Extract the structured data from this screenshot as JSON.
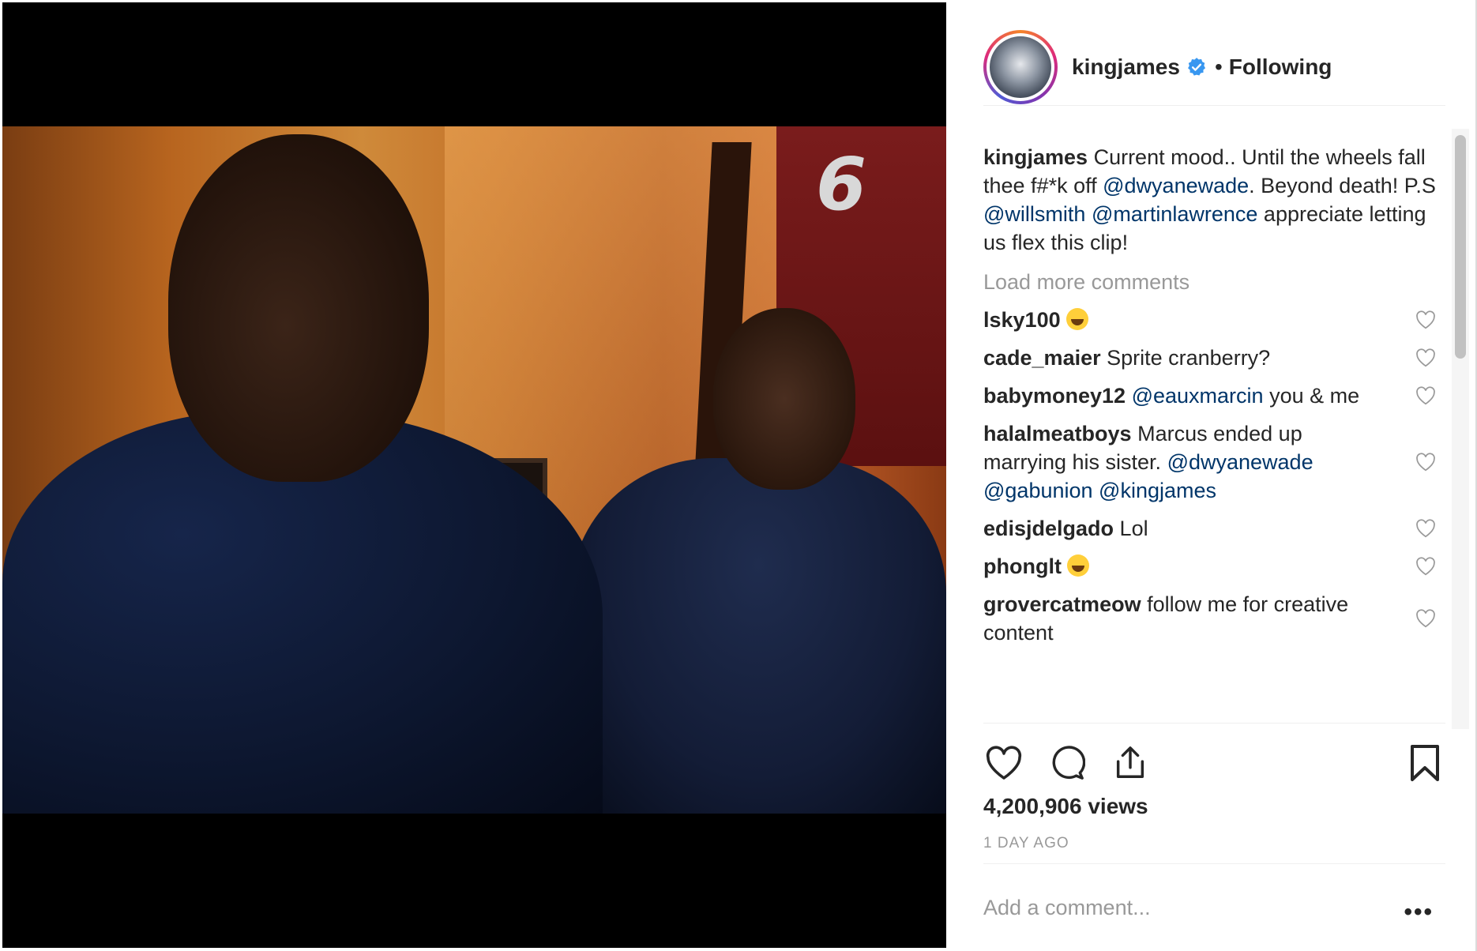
{
  "post": {
    "username": "kingjames",
    "dot": "•",
    "follow_status": "Following",
    "jersey_number": "6"
  },
  "caption": {
    "user": "kingjames",
    "text_1": " Current mood.. Until the wheels fall thee f#*k off ",
    "mention_1": "@dwyanewade",
    "text_2": ". Beyond death! P.S ",
    "mention_2": "@willsmith",
    "text_3": " ",
    "mention_3": "@martinlawrence",
    "text_4": " appreciate letting us flex this clip!"
  },
  "load_more": "Load more comments",
  "comments": [
    {
      "user": "lsky100",
      "emoji": "laughing-emoji"
    },
    {
      "user": "cade_maier",
      "text": " Sprite cranberry?"
    },
    {
      "user": "babymoney12",
      "mention": "@eauxmarcin",
      "text": " you & me"
    },
    {
      "user": "halalmeatboys",
      "text": " Marcus ended up marrying his sister. ",
      "mention_a": "@dwyanewade",
      "mention_b": "@gabunion",
      "mention_c": "@kingjames"
    },
    {
      "user": "edisjdelgado",
      "text": " Lol"
    },
    {
      "user": "phonglt",
      "emoji": "laughing-emoji"
    },
    {
      "user": "grovercatmeow",
      "text": " follow me for creative content"
    }
  ],
  "stats": {
    "views": "4,200,906 views",
    "time": "1 DAY AGO"
  },
  "composer": {
    "placeholder": "Add a comment...",
    "more": "•••"
  },
  "colors": {
    "mention": "#003569",
    "muted": "#999999",
    "text": "#262626",
    "verified": "#3897f0"
  }
}
